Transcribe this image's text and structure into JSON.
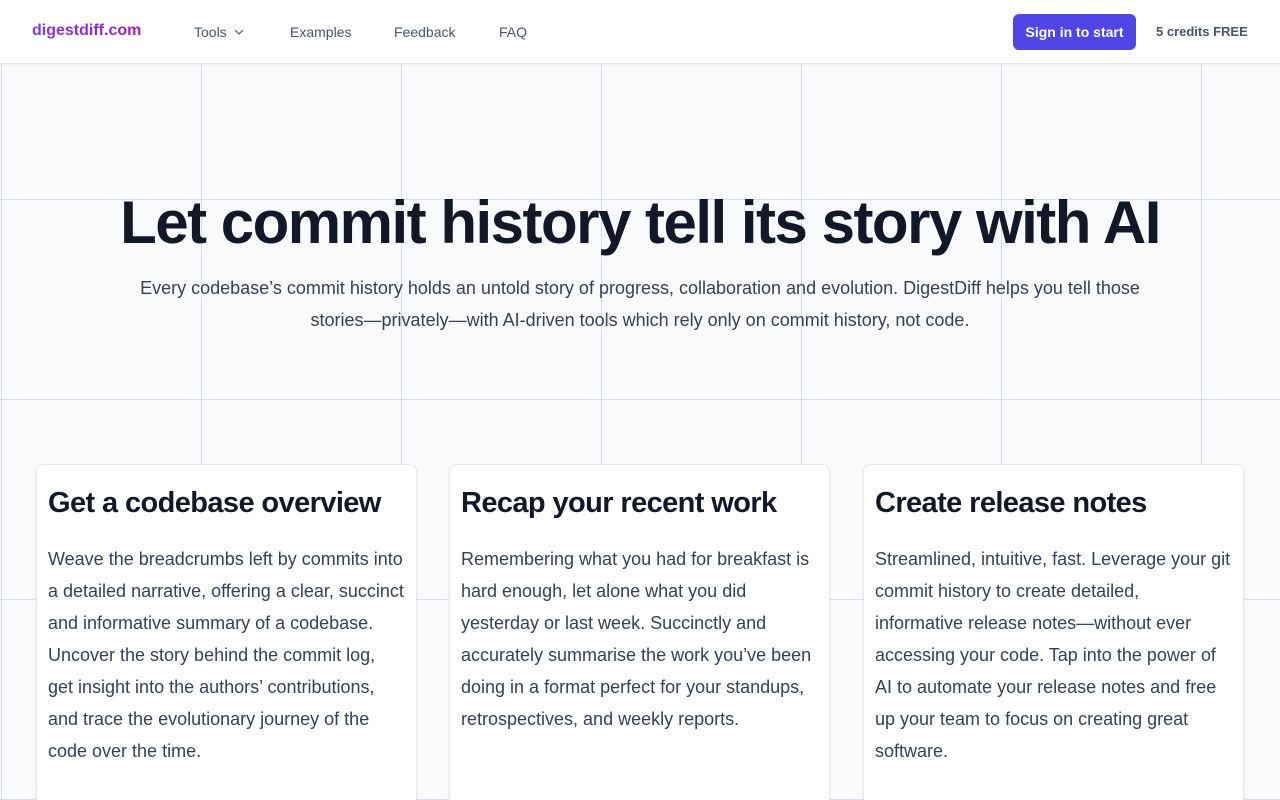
{
  "header": {
    "logo": "digestdiff.com",
    "nav": {
      "tools": "Tools",
      "examples": "Examples",
      "feedback": "Feedback",
      "faq": "FAQ"
    },
    "signin_label": "Sign in to start",
    "credits": "5 credits FREE"
  },
  "hero": {
    "title": "Let commit history tell its story with AI",
    "subtitle": "Every codebase’s commit history holds an untold story of progress, collaboration and evolution. DigestDiff helps you tell those stories—privately—with AI-driven tools which rely only on commit history, not code."
  },
  "cards": [
    {
      "title": "Get a codebase overview",
      "body": "Weave the breadcrumbs left by commits into a detailed narrative, offering a clear, succinct and informative summary of a codebase. Uncover the story behind the commit log, get insight into the authors’ contributions, and trace the evolutionary journey of the code over the time."
    },
    {
      "title": "Recap your recent work",
      "body": "Remembering what you had for breakfast is hard enough, let alone what you did yesterday or last week. Succinctly and accurately summarise the work you’ve been doing in a format perfect for your standups, retrospectives, and weekly reports."
    },
    {
      "title": "Create release notes",
      "body": "Streamlined, intuitive, fast. Leverage your git commit history to create detailed, informative release notes—without ever accessing your code. Tap into the power of AI to automate your release notes and free up your team to focus on creating great software."
    }
  ],
  "colors": {
    "accent": "#4f46e5",
    "logo_gradient_start": "#7c3aed",
    "logo_gradient_end": "#a21caf",
    "grid_line": "#c7d2fe"
  },
  "icons": {
    "tools_dropdown": "chevron-down-icon"
  }
}
